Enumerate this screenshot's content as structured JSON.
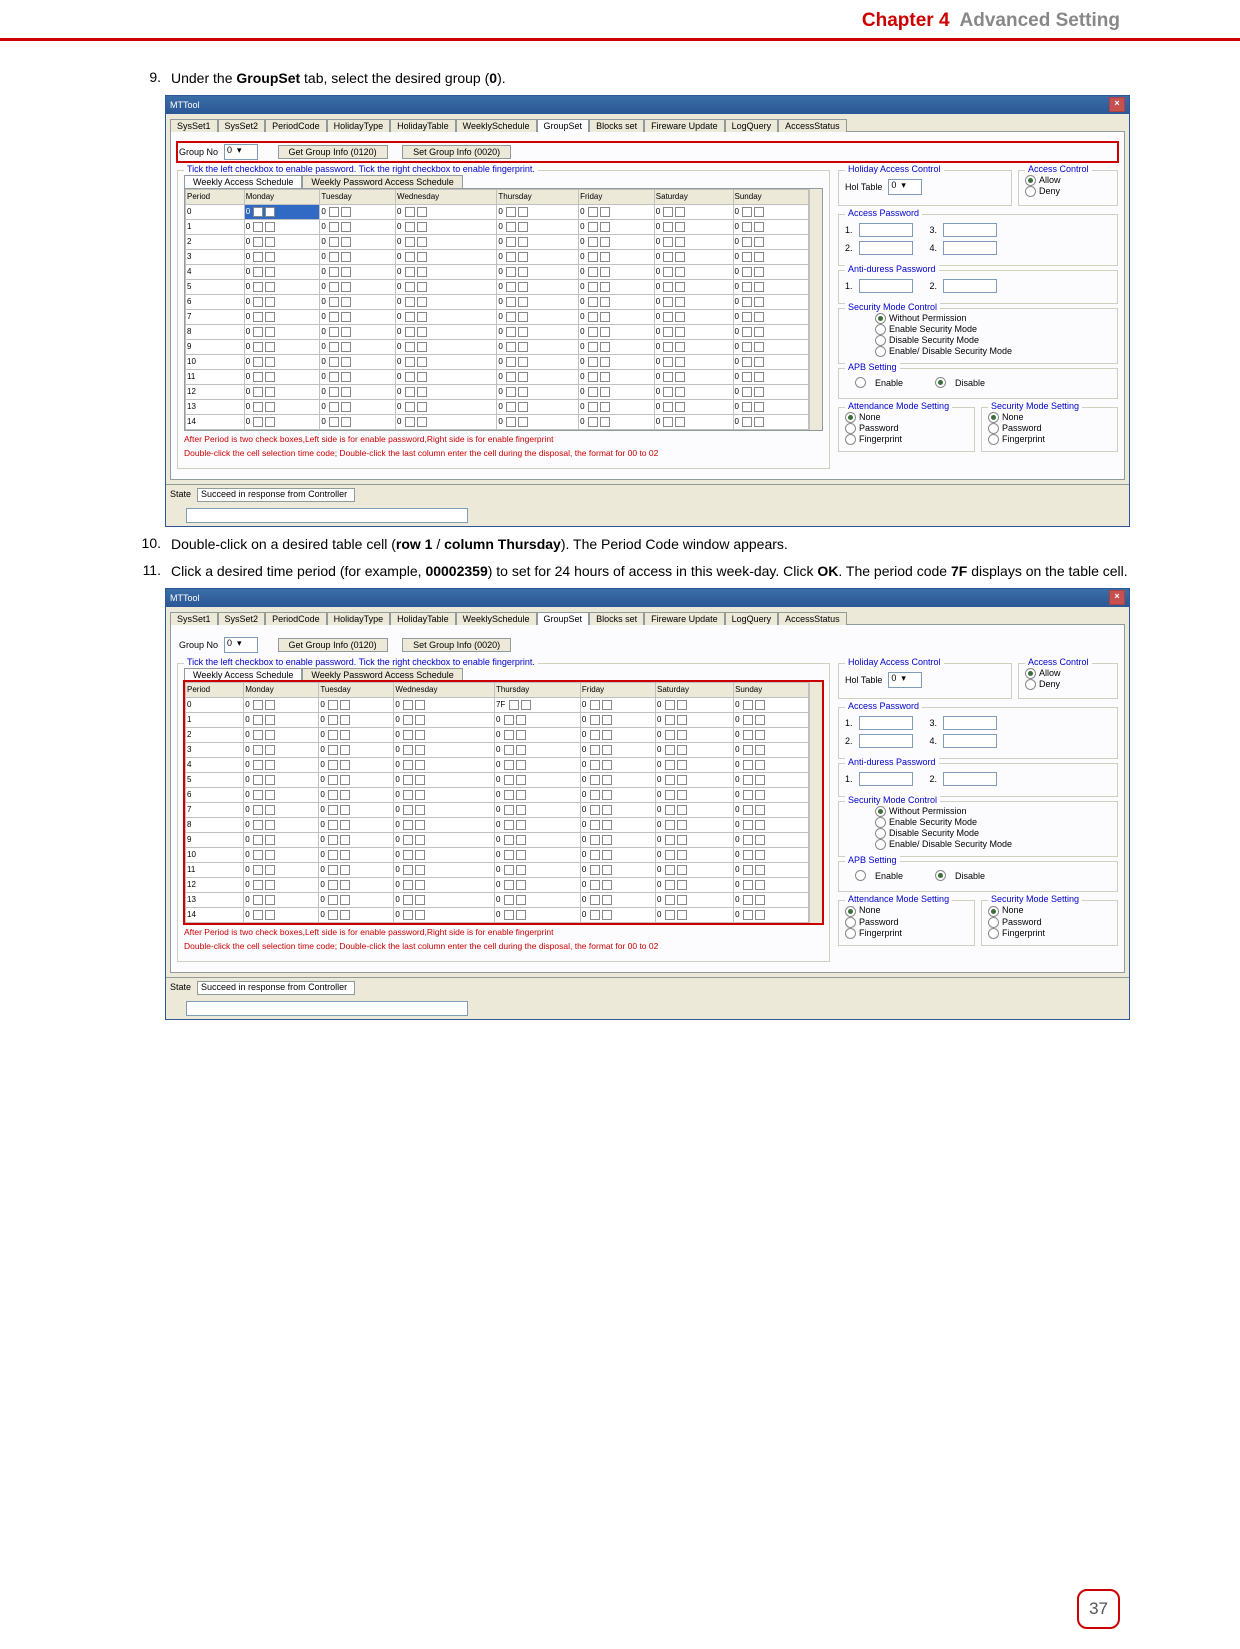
{
  "header": {
    "chapter": "Chapter 4",
    "title": "Advanced Setting"
  },
  "steps": {
    "s9": {
      "num": "9.",
      "text_a": "Under the ",
      "b1": "GroupSet",
      "text_b": " tab, select the desired group (",
      "b2": "0",
      "text_c": ")."
    },
    "s10": {
      "num": "10.",
      "text_a": "Double-click on a desired table cell (",
      "b1": "row 1",
      "sep": " / ",
      "b2": "column Thursday",
      "text_b": "). The Period Code window appears."
    },
    "s11": {
      "num": "11.",
      "text_a": "Click a desired time period (for example, ",
      "b1": "00002359",
      "text_b": ") to set for 24 hours of access in this week-day. Click ",
      "b2": "OK",
      "text_c": ". The period code ",
      "b3": "7F",
      "text_d": " displays on the table cell."
    }
  },
  "win": {
    "title": "MTTool",
    "tabs": [
      "SysSet1",
      "SysSet2",
      "PeriodCode",
      "HolidayType",
      "HolidayTable",
      "WeeklySchedule",
      "GroupSet",
      "Blocks set",
      "Fireware Update",
      "LogQuery",
      "AccessStatus"
    ],
    "group_no_label": "Group No",
    "group_no_value": "0",
    "btn_get": "Get Group Info (0120)",
    "btn_set": "Set Group Info (0020)",
    "fs_label": "Tick the left checkbox to enable password. Tick the right checkbox to enable fingerprint.",
    "subtabs": [
      "Weekly Access Schedule",
      "Weekly Password Access Schedule"
    ],
    "table_headers": [
      "Period",
      "Monday",
      "Tuesday",
      "Wednesday",
      "Thursday",
      "Friday",
      "Saturday",
      "Sunday"
    ],
    "rows": [
      "0",
      "1",
      "2",
      "3",
      "4",
      "5",
      "6",
      "7",
      "8",
      "9",
      "10",
      "11",
      "12",
      "13",
      "14"
    ],
    "cell_value": "0",
    "cell_7f": "7F",
    "hint1": "After Period is two check boxes,Left side is for enable password,Right side is for enable fingerprint",
    "hint2": "Double-click the cell selection time code; Double-click the last column enter the cell during the disposal, the format for 00 to 02",
    "state_label": "State",
    "state_value": "Succeed in response from Controller",
    "hac": {
      "title": "Holiday Access Control",
      "label": "Hol Table",
      "value": "0"
    },
    "ac": {
      "title": "Access Control",
      "allow": "Allow",
      "deny": "Deny"
    },
    "ap": {
      "title": "Access Password",
      "n1": "1.",
      "n2": "2.",
      "n3": "3.",
      "n4": "4."
    },
    "adp": {
      "title": "Anti-duress Password",
      "n1": "1.",
      "n2": "2."
    },
    "smc": {
      "title": "Security Mode Control",
      "o1": "Without Permission",
      "o2": "Enable Security Mode",
      "o3": "Disable Security Mode",
      "o4": "Enable/ Disable Security Mode"
    },
    "apb": {
      "title": "APB Setting",
      "enable": "Enable",
      "disable": "Disable"
    },
    "ams": {
      "title": "Attendance Mode Setting",
      "none": "None",
      "pw": "Password",
      "fp": "Fingerprint"
    },
    "sms": {
      "title": "Security Mode Setting",
      "none": "None",
      "pw": "Password",
      "fp": "Fingerprint"
    }
  },
  "page_number": "37"
}
